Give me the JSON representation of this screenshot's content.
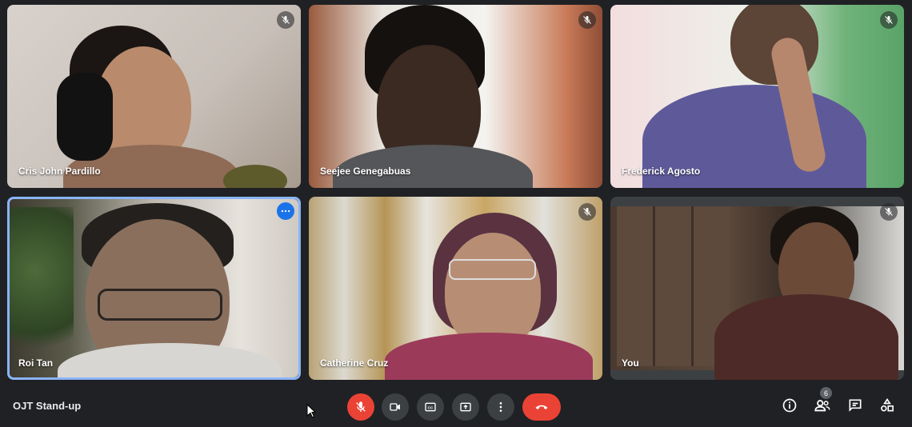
{
  "meeting": {
    "title": "OJT Stand-up"
  },
  "participants": [
    {
      "name": "Cris John Pardillo",
      "muted": true
    },
    {
      "name": "Seejee Genegabuas",
      "muted": true
    },
    {
      "name": "Frederick Agosto",
      "muted": true
    },
    {
      "name": "Roi Tan",
      "muted": false,
      "speaking": true
    },
    {
      "name": "Catherine Cruz",
      "muted": true
    },
    {
      "name": "You",
      "muted": true
    }
  ],
  "controls": {
    "mic": "mic-off-icon",
    "camera": "videocam-icon",
    "captions": "captions-icon",
    "present": "present-screen-icon",
    "more": "more-vert-icon",
    "leave": "call-end-icon"
  },
  "right_controls": {
    "info": "info-icon",
    "people": "people-icon",
    "people_count": "6",
    "chat": "chat-icon",
    "activities": "activities-icon"
  },
  "colors": {
    "accent": "#8ab4f8",
    "danger": "#ea4335",
    "background": "#202124"
  }
}
